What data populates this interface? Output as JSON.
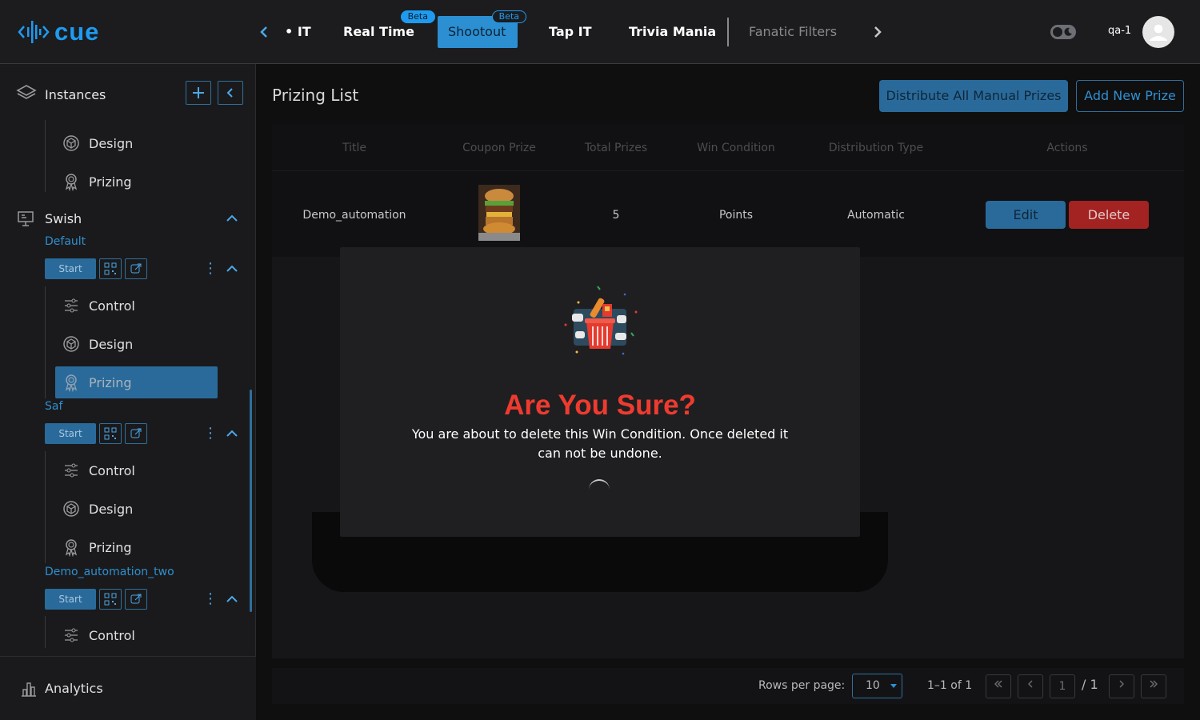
{
  "header": {
    "brand": "cue",
    "tabs": [
      {
        "label": "IT",
        "partial_prefix": "•"
      },
      {
        "label": "Real Time",
        "badge": "Beta"
      },
      {
        "label": "Shootout",
        "badge": "Beta",
        "active": true
      },
      {
        "label": "Tap IT"
      },
      {
        "label": "Trivia Mania"
      },
      {
        "label": "Fanatic Filters",
        "muted": true
      }
    ],
    "username": "qa-1"
  },
  "sidebar": {
    "instances_label": "Instances",
    "top_items": [
      {
        "label": "Design",
        "icon": "design-icon"
      },
      {
        "label": "Prizing",
        "icon": "prizing-icon"
      }
    ],
    "game_name": "Swish",
    "instances": [
      {
        "name": "Default",
        "start_label": "Start",
        "items": [
          {
            "label": "Control",
            "icon": "control-icon"
          },
          {
            "label": "Design",
            "icon": "design-icon"
          },
          {
            "label": "Prizing",
            "icon": "prizing-icon",
            "active": true
          }
        ]
      },
      {
        "name": "Saf",
        "start_label": "Start",
        "items": [
          {
            "label": "Control",
            "icon": "control-icon"
          },
          {
            "label": "Design",
            "icon": "design-icon"
          },
          {
            "label": "Prizing",
            "icon": "prizing-icon"
          }
        ]
      },
      {
        "name": "Demo_automation_two",
        "start_label": "Start",
        "items": [
          {
            "label": "Control",
            "icon": "control-icon"
          }
        ]
      }
    ],
    "analytics_label": "Analytics"
  },
  "main": {
    "title": "Prizing List",
    "distribute_label": "Distribute All Manual Prizes",
    "add_label": "Add New Prize",
    "columns": [
      "Title",
      "Coupon Prize",
      "Total Prizes",
      "Win Condition",
      "Distribution Type",
      "Actions"
    ],
    "rows": [
      {
        "title": "Demo_automation",
        "total": "5",
        "win_condition": "Points",
        "distribution": "Automatic",
        "edit": "Edit",
        "delete": "Delete"
      }
    ],
    "pagination": {
      "rows_per_page_label": "Rows per page:",
      "rows_per_page": "10",
      "range": "1–1 of 1",
      "page": "1",
      "total_pages": "/ 1"
    }
  },
  "modal": {
    "title": "Are You Sure?",
    "message": "You are about to delete this Win Condition. Once deleted it can not be undone."
  },
  "colors": {
    "accent": "#1e9bf0",
    "primary_button": "#2a6a9a",
    "danger": "#a32222",
    "title_red": "#ef3b2f"
  }
}
